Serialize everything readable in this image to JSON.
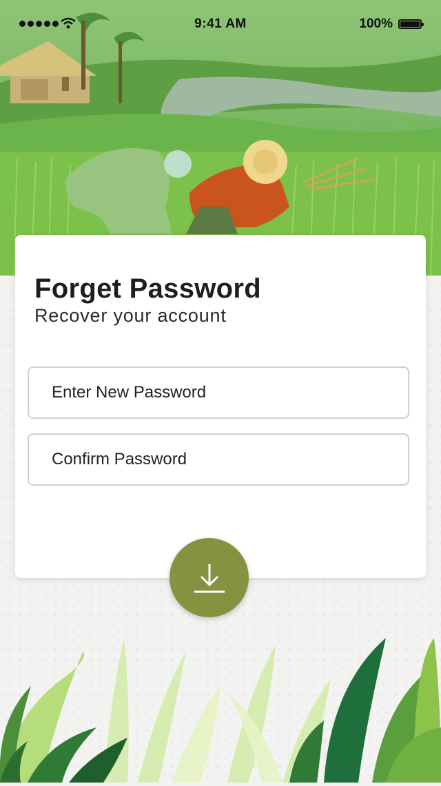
{
  "status_bar": {
    "time": "9:41 AM",
    "battery": "100%"
  },
  "card": {
    "title": "Forget Password",
    "subtitle": "Recover your account",
    "new_password_placeholder": "Enter New Password",
    "confirm_password_placeholder": "Confirm Password"
  },
  "submit_button": {
    "icon": "download-icon"
  },
  "colors": {
    "accent": "#869240",
    "field_border": "#cfcfcf",
    "hero_sky": "#86c06a"
  }
}
